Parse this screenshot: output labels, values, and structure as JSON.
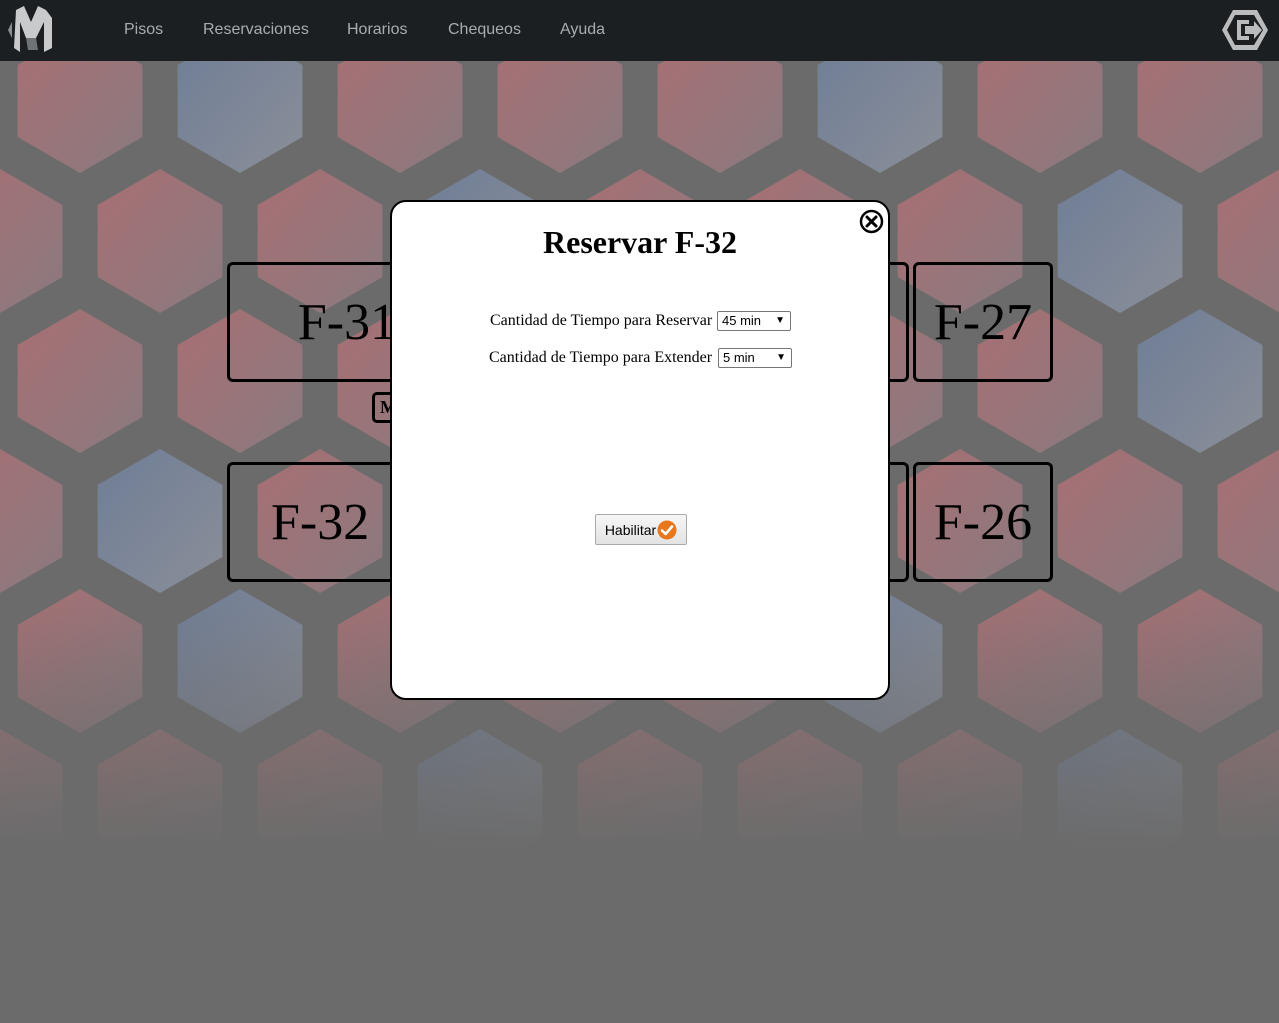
{
  "nav": {
    "items": [
      {
        "label": "Pisos"
      },
      {
        "label": "Reservaciones"
      },
      {
        "label": "Horarios"
      },
      {
        "label": "Chequeos"
      },
      {
        "label": "Ayuda"
      }
    ]
  },
  "rooms": {
    "r1": "F-31",
    "r2": "F-27",
    "r3": "F-32",
    "r4": "F-26",
    "mini": "M"
  },
  "modal": {
    "title": "Reservar F-32",
    "reserve_label": "Cantidad de Tiempo para Reservar",
    "reserve_value": "45 min",
    "extend_label": "Cantidad de Tiempo para Extender",
    "extend_value": "5 min",
    "button_label": "Habilitar"
  },
  "icons": {
    "logo": "logo-icon",
    "exit": "exit-icon",
    "close": "close-icon",
    "check": "check-icon"
  },
  "colors": {
    "topbar": "#1c1f22",
    "nav_text": "#a9acaf",
    "check_orange": "#e8761c"
  }
}
